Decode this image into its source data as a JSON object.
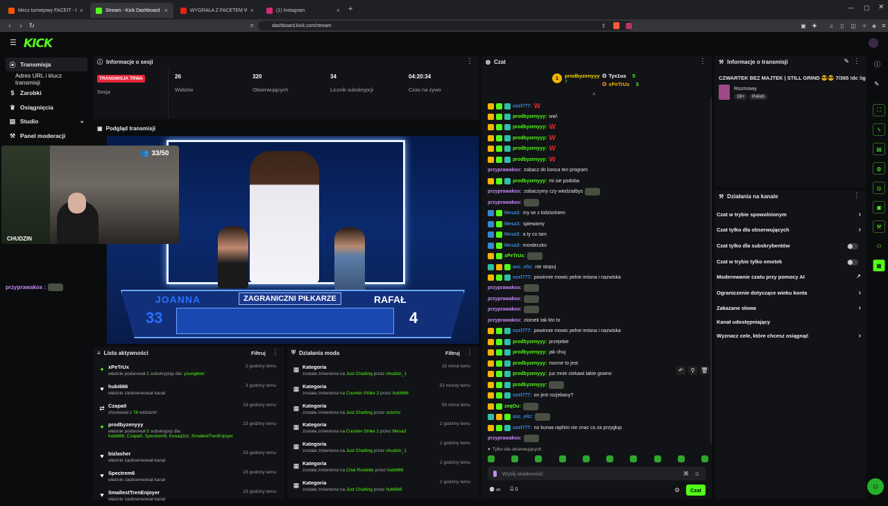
{
  "browser": {
    "tabs": [
      {
        "title": "Mecz turniejowy FACEIT - FACEIT.com"
      },
      {
        "title": "Stream - Kick Dashboard"
      },
      {
        "title": "WYGRAŁA Z FACETEM W TYPOWO M"
      },
      {
        "title": "(1) Instagram"
      }
    ],
    "url": "dashboard.kick.com/stream"
  },
  "brand": {
    "logo": "KICK",
    "accent": "#53fc18"
  },
  "sidebar": {
    "items": [
      {
        "label": "Transmisja",
        "icon": "broadcast-icon"
      },
      {
        "label": "Adres URL i klucz transmisji"
      },
      {
        "label": "Zarobki",
        "icon": "dollar-icon"
      },
      {
        "label": "Osiągnięcia",
        "icon": "trophy-icon"
      },
      {
        "label": "Studio",
        "icon": "studio-icon"
      },
      {
        "label": "Panel moderacji",
        "icon": "wrench-icon"
      }
    ]
  },
  "session": {
    "title": "Informacje o sesji",
    "status_badge": "TRANSMISJA TRWA",
    "status_label": "Sesja",
    "stats": [
      {
        "value": "26",
        "label": "Widzów"
      },
      {
        "value": "320",
        "label": "Obserwujących"
      },
      {
        "value": "34",
        "label": "Licznik subskrypcji"
      },
      {
        "value": "04:20:34",
        "label": "Czas na żywo"
      }
    ]
  },
  "preview": {
    "title": "Podgląd transmisji",
    "viewer_count": "33/50",
    "cam_label": "CHUDZIN",
    "overlay_chat_user": "przyprawakox :",
    "tv": {
      "left_name": "JOANNA",
      "right_name": "RAFAŁ",
      "category": "ZAGRANICZNI PIŁKARZE",
      "left_score": "33",
      "right_score": "4"
    }
  },
  "activity": {
    "title": "Lista aktywności",
    "filter": "Filtruj",
    "items": [
      {
        "name": "xPeTrUx",
        "desc_pre": "właśnie podarował ",
        "desc_num": "1",
        "desc_mid": " subskrypcję dla: ",
        "desc_user": "youngklon",
        "time": "2 godziny temu"
      },
      {
        "name": "hubi666",
        "desc_pre": "właśnie zaobserwował kanał",
        "time": "3 godziny temu"
      },
      {
        "name": "Czapa0",
        "desc_pre": "zhostował z ",
        "desc_num": "78",
        "desc_mid": " widzami!",
        "time": "23 godziny temu"
      },
      {
        "name": "prodbyzenyyy",
        "desc_pre": "właśnie podarował ",
        "desc_num": "5",
        "desc_mid": " subskrypcji dla:",
        "desc_user": "hubi666, Czapa0, Spectrem6, Kosaq3zz, SmallestTrenEnjoyer",
        "time": "23 godziny temu"
      },
      {
        "name": "bizlasher",
        "desc_pre": "właśnie zaobserwował kanał",
        "time": "23 godziny temu"
      },
      {
        "name": "Spectrem6",
        "desc_pre": "właśnie zaobserwował kanał",
        "time": "23 godziny temu"
      },
      {
        "name": "SmallestTrenEnjoyer",
        "desc_pre": "właśnie zaobserwował kanał",
        "time": "23 godziny temu"
      }
    ]
  },
  "modactions": {
    "title": "Działania moda",
    "filter": "Filtruj",
    "items": [
      {
        "name": "Kategoria",
        "cat": "Just Chatting",
        "user": "chudzin_1",
        "time": "15 minut temu"
      },
      {
        "name": "Kategoria",
        "cat": "Counter-Strike 2",
        "user": "hubi666",
        "time": "53 minuty temu"
      },
      {
        "name": "Kategoria",
        "cat": "Just Chatting",
        "user": "octoms",
        "time": "59 minut temu"
      },
      {
        "name": "Kategoria",
        "cat": "Counter-Strike 2",
        "user": "Mesa3",
        "time": "2 godziny temu"
      },
      {
        "name": "Kategoria",
        "cat": "Just Chatting",
        "user": "chudzin_1",
        "time": "2 godziny temu"
      },
      {
        "name": "Kategoria",
        "cat": "Chat Roulette",
        "user": "hubi666",
        "time": "2 godziny temu"
      },
      {
        "name": "Kategoria",
        "cat": "Just Chatting",
        "user": "hubi666",
        "time": "2 godziny temu"
      }
    ],
    "changed_text": "została zmieniona na",
    "by_text": "przez"
  },
  "chat": {
    "title": "Czat",
    "top_gifters": [
      {
        "name": "prodbyzenyyy",
        "count": "7"
      },
      {
        "name": "Tyx1us",
        "count": "5"
      },
      {
        "name": "xPeTrUx",
        "count": "3"
      }
    ],
    "messages": [
      {
        "badges": [
          "b1",
          "b3",
          "b4"
        ],
        "user": "ozel777:",
        "ucolor": "#3a86d4",
        "text": "",
        "w": true
      },
      {
        "badges": [
          "b1",
          "b3",
          "b4"
        ],
        "user": "prodbyzenyyy:",
        "ucolor": "#53fc18",
        "text": "ww\\"
      },
      {
        "badges": [
          "b1",
          "b3",
          "b4"
        ],
        "user": "prodbyzenyyy:",
        "ucolor": "#53fc18",
        "text": "",
        "w": true
      },
      {
        "badges": [
          "b1",
          "b3",
          "b4"
        ],
        "user": "prodbyzenyyy:",
        "ucolor": "#53fc18",
        "text": "",
        "w": true
      },
      {
        "badges": [
          "b1",
          "b3",
          "b4"
        ],
        "user": "prodbyzenyyy:",
        "ucolor": "#53fc18",
        "text": "",
        "w": true
      },
      {
        "badges": [
          "b1",
          "b3",
          "b4"
        ],
        "user": "prodbyzenyyy:",
        "ucolor": "#53fc18",
        "text": "",
        "w": true
      },
      {
        "badges": [],
        "user": "przyprawakox:",
        "ucolor": "#c58af9",
        "text": "zobacz do konca ten program"
      },
      {
        "badges": [
          "b1",
          "b3",
          "b4"
        ],
        "user": "prodbyzenyyy:",
        "ucolor": "#53fc18",
        "text": "mi sie podoba"
      },
      {
        "badges": [],
        "user": "przyprawakox:",
        "ucolor": "#c58af9",
        "text": "zobaczymy czy wiedzialbys",
        "emote": true
      },
      {
        "badges": [],
        "user": "przyprawakox:",
        "ucolor": "#c58af9",
        "text": "",
        "emote": true
      },
      {
        "badges": [
          "b2",
          "b3"
        ],
        "user": "Mesa3:",
        "ucolor": "#3a86d4",
        "text": "my se z kidziorkiem"
      },
      {
        "badges": [
          "b2",
          "b3"
        ],
        "user": "Mesa3:",
        "ucolor": "#3a86d4",
        "text": "spiewamy"
      },
      {
        "badges": [
          "b2",
          "b3"
        ],
        "user": "Mesa3:",
        "ucolor": "#3a86d4",
        "text": "a ty co tam"
      },
      {
        "badges": [
          "b2",
          "b3"
        ],
        "user": "Mesa3:",
        "ucolor": "#3a86d4",
        "text": "mordeczko"
      },
      {
        "badges": [
          "b1",
          "b3"
        ],
        "user": "xPeTrUx:",
        "ucolor": "#53fc18",
        "text": "",
        "emote": true
      },
      {
        "badges": [
          "b4",
          "b1",
          "b3"
        ],
        "user": "asc_eliz:",
        "ucolor": "#3a86d4",
        "text": "nie stopuj"
      },
      {
        "badges": [
          "b1",
          "b3",
          "b4"
        ],
        "user": "ozel777:",
        "ucolor": "#3a86d4",
        "text": "powinnie mowic pelne imiona i nazwiska"
      },
      {
        "badges": [],
        "user": "przyprawakox:",
        "ucolor": "#c58af9",
        "text": "",
        "emote": true
      },
      {
        "badges": [],
        "user": "przyprawakox:",
        "ucolor": "#c58af9",
        "text": "",
        "emote": true
      },
      {
        "badges": [],
        "user": "przyprawakox:",
        "ucolor": "#c58af9",
        "text": "",
        "emote": true
      },
      {
        "badges": [],
        "user": "przyprawakox:",
        "ucolor": "#c58af9",
        "text": "ziomek tak kto to"
      },
      {
        "badges": [
          "b1",
          "b3",
          "b4"
        ],
        "user": "ozel777:",
        "ucolor": "#3a86d4",
        "text": "powinnie mowic pelne imiona i nazwiska"
      },
      {
        "badges": [
          "b1",
          "b3",
          "b4"
        ],
        "user": "prodbyzenyyy:",
        "ucolor": "#53fc18",
        "text": "przejebie"
      },
      {
        "badges": [
          "b1",
          "b3",
          "b4"
        ],
        "user": "prodbyzenyyy:",
        "ucolor": "#53fc18",
        "text": "jak chuj"
      },
      {
        "badges": [
          "b1",
          "b3",
          "b4"
        ],
        "user": "prodbyzenyyy:",
        "ucolor": "#53fc18",
        "text": "mocne to jest"
      },
      {
        "badges": [
          "b1",
          "b3",
          "b4"
        ],
        "user": "prodbyzenyyy:",
        "ucolor": "#53fc18",
        "text": "juz mnie ciekawi takie gowno"
      },
      {
        "badges": [
          "b1",
          "b3",
          "b4"
        ],
        "user": "prodbyzenyyy:",
        "ucolor": "#53fc18",
        "text": "",
        "emote": true
      },
      {
        "badges": [
          "b1",
          "b3",
          "b4"
        ],
        "user": "ozel777:",
        "ucolor": "#3a86d4",
        "text": "on jest rozjebany?"
      },
      {
        "badges": [
          "b1",
          "b3"
        ],
        "user": "zeqOu:",
        "ucolor": "#53fc18",
        "text": "",
        "emote": true
      },
      {
        "badges": [
          "b4",
          "b1",
          "b3"
        ],
        "user": "asc_eliz:",
        "ucolor": "#3a86d4",
        "text": "",
        "emote": true
      },
      {
        "badges": [
          "b1",
          "b3",
          "b4"
        ],
        "user": "ozel777:",
        "ucolor": "#3a86d4",
        "text": "no kurwa raphini nie znac co za przygłup"
      },
      {
        "badges": [],
        "user": "przyprawakox:",
        "ucolor": "#c58af9",
        "text": "",
        "emote": true
      }
    ],
    "followers_only": "Tylko dla obserwujących",
    "input_placeholder": "Wyślij wiadomość",
    "send_label": "Czat",
    "viewers_count": "0",
    "infinity": "∞"
  },
  "streaminfo": {
    "title": "Informacje o transmisji",
    "stream_title": "CZWARTEK BEZ MAJTEK | STILL GRIND 😎😎 7/365 !dc !ig",
    "category": "Rozmowy",
    "tags": [
      "18+",
      "Polish"
    ]
  },
  "channel_actions": {
    "title": "Działania na kanale",
    "items": [
      {
        "label": "Czat w trybie spowolnionym",
        "control": "chevron"
      },
      {
        "label": "Czat tylko dla obserwujących",
        "control": "chevron"
      },
      {
        "label": "Czat tylko dla subskrybentów",
        "control": "toggle"
      },
      {
        "label": "Czat w trybie tylko emotek",
        "control": "toggle"
      },
      {
        "label": "Moderowanie czatu przy pomocy AI",
        "control": "link"
      },
      {
        "label": "Ograniczenie dotyczące wieku konta",
        "control": "chevron"
      },
      {
        "label": "Zakazane słowa",
        "control": "chevron"
      },
      {
        "label": "Kanał udostępniający",
        "control": "none"
      },
      {
        "label": "Wyznacz cele, które chcesz osiągnąć",
        "control": "chevron"
      }
    ]
  }
}
